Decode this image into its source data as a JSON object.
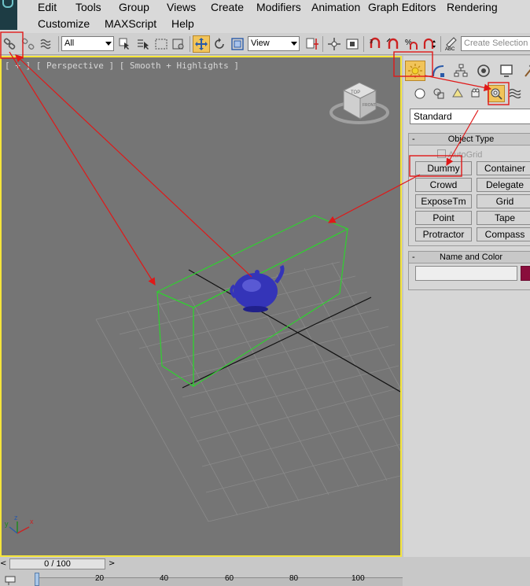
{
  "menu": {
    "row1": [
      "Edit",
      "Tools",
      "Group",
      "Views",
      "Create",
      "Modifiers",
      "Animation",
      "Graph Editors",
      "Rendering"
    ],
    "row2": [
      "Customize",
      "MAXScript",
      "Help"
    ]
  },
  "toolbar": {
    "selection_filter": "All",
    "reference_coord": "View",
    "selection_set_placeholder": "Create Selection S"
  },
  "viewport": {
    "label": "[ + ] [ Perspective ] [ Smooth + Highlights ]",
    "viewcube_top": "TOP",
    "viewcube_front": "FRONT",
    "axis_labels": [
      "y",
      "z",
      "x"
    ]
  },
  "command_panel": {
    "category_dropdown": "Standard",
    "object_type": {
      "title": "Object Type",
      "collapse_symbol": "-",
      "autogrid_label": "AutoGrid",
      "buttons": [
        "Dummy",
        "Container",
        "Crowd",
        "Delegate",
        "ExposeTm",
        "Grid",
        "Point",
        "Tape",
        "Protractor",
        "Compass"
      ]
    },
    "name_and_color": {
      "title": "Name and Color",
      "collapse_symbol": "-",
      "color": "#8a0d3c"
    }
  },
  "time_slider": {
    "value": "0 / 100",
    "prev_symbol": "<",
    "next_symbol": ">"
  },
  "trackbar": {
    "ticks": [
      "20",
      "40",
      "60",
      "80",
      "100"
    ]
  },
  "colors": {
    "viewport_bg": "#757575",
    "active_viewport_border": "#f5e53a",
    "box_wire": "#30d030",
    "teapot": "#3434b8",
    "annotation": "#e01818"
  }
}
